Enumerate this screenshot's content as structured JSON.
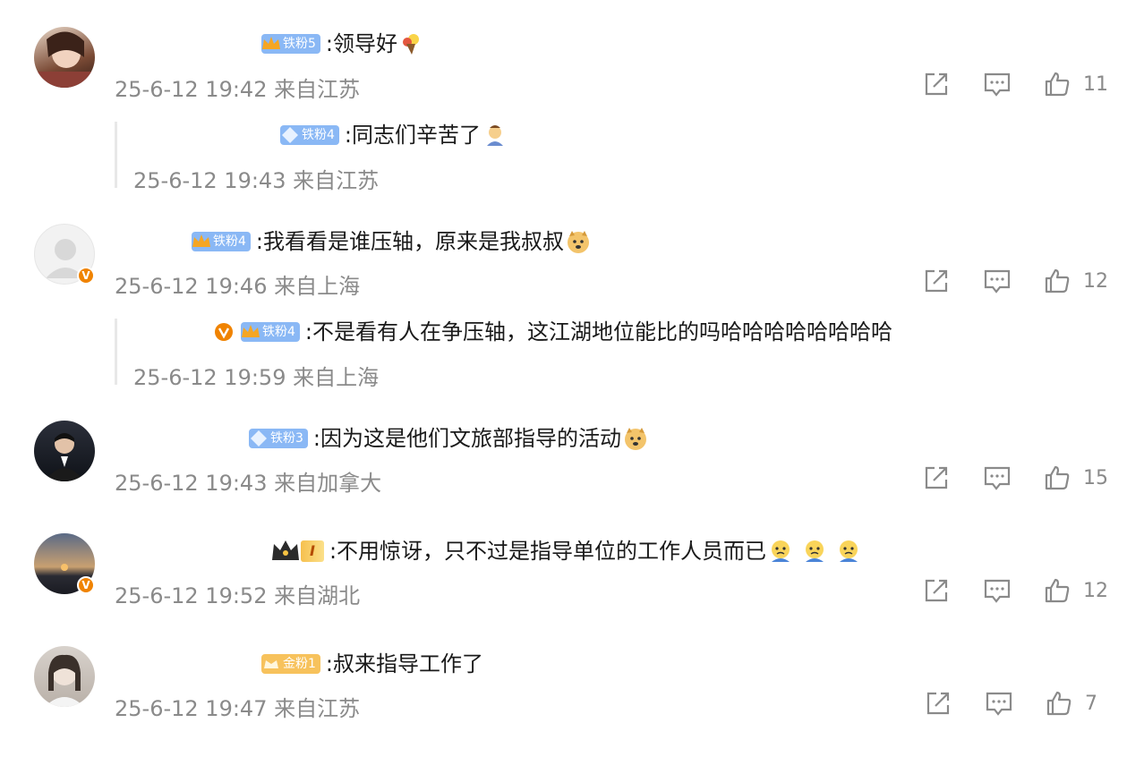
{
  "comments": [
    {
      "badge": "铁粉5",
      "text": ":领导好",
      "emoji": "bouquet-emoji",
      "meta": "25-6-12 19:42 来自江苏",
      "likes": "11",
      "reply": {
        "badge": "铁粉4",
        "text": ":同志们辛苦了",
        "emoji": "saluting-person-emoji",
        "meta": "25-6-12 19:43 来自江苏"
      }
    },
    {
      "badge": "铁粉4",
      "text": ":我看看是谁压轴，原来是我叔叔",
      "emoji": "doge-emoji",
      "meta": "25-6-12 19:46 来自上海",
      "likes": "12",
      "reply": {
        "badge": "铁粉4",
        "text": ":不是看有人在争压轴，这江湖地位能比的吗哈哈哈哈哈哈哈哈",
        "meta": "25-6-12 19:59 来自上海"
      }
    },
    {
      "badge": "铁粉3",
      "text": ":因为这是他们文旅部指导的活动",
      "emoji": "doge-emoji",
      "meta": "25-6-12 19:43 来自加拿大",
      "likes": "15"
    },
    {
      "badge": "I",
      "text": ":不用惊讶，只不过是指导单位的工作人员而已",
      "emoji": "crying-emoji",
      "meta": "25-6-12 19:52 来自湖北",
      "likes": "12"
    },
    {
      "badge": "金粉1",
      "text": ":叔来指导工作了",
      "meta": "25-6-12 19:47 来自江苏",
      "likes": "7"
    }
  ],
  "colors": {
    "meta": "#8a8a8a",
    "blue_badge": "#8ab8f5",
    "gold_badge": "#f7c25c",
    "verified": "#f08300"
  }
}
